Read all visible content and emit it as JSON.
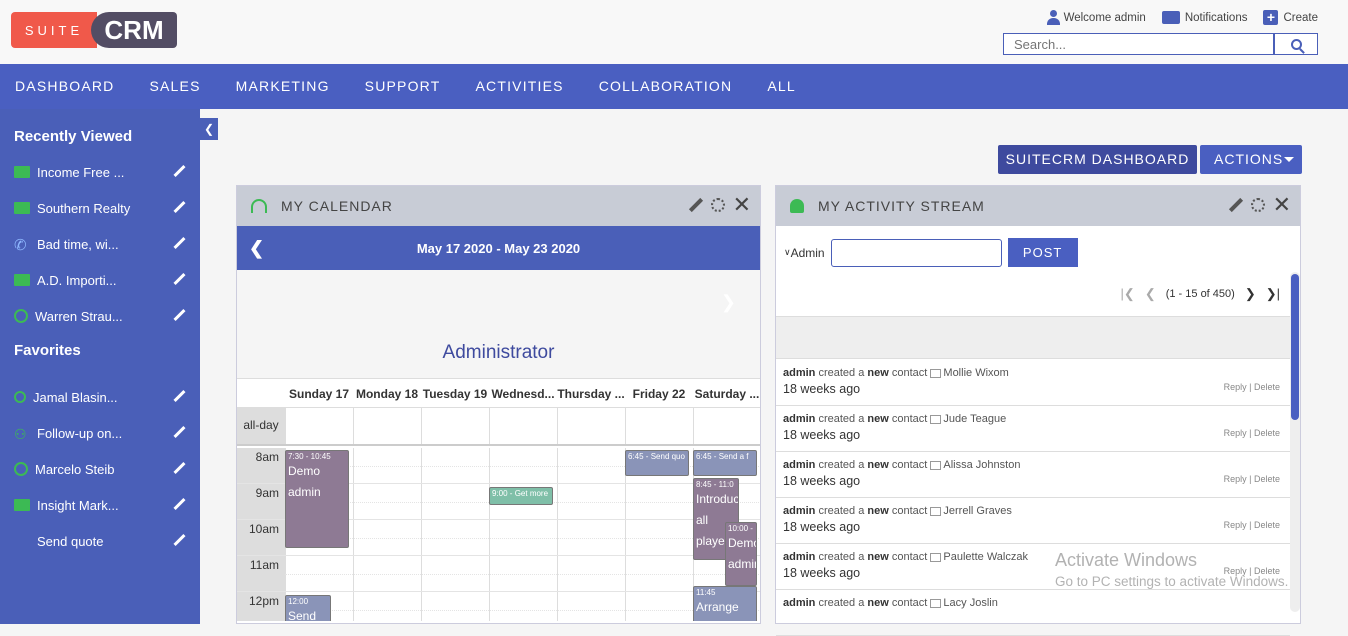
{
  "header": {
    "logo_suite": "SUITE",
    "logo_crm": "CRM",
    "welcome": "Welcome admin",
    "notifications": "Notifications",
    "create": "Create",
    "search_placeholder": "Search..."
  },
  "nav": [
    "DASHBOARD",
    "SALES",
    "MARKETING",
    "SUPPORT",
    "ACTIVITIES",
    "COLLABORATION",
    "ALL"
  ],
  "sidebar": {
    "recent_title": "Recently Viewed",
    "recent": [
      {
        "label": "Income Free ...",
        "icon": "folder-icon"
      },
      {
        "label": "Southern Realty",
        "icon": "folder-icon"
      },
      {
        "label": "Bad time, wi...",
        "icon": "phone-icon"
      },
      {
        "label": "A.D. Importi...",
        "icon": "folder-icon"
      },
      {
        "label": "Warren Strau...",
        "icon": "contact-icon"
      }
    ],
    "fav_title": "Favorites",
    "favorites": [
      {
        "label": "Jamal Blasin...",
        "icon": "search-icon"
      },
      {
        "label": "Follow-up on...",
        "icon": "binoculars-icon"
      },
      {
        "label": "Marcelo Steib",
        "icon": "contact-icon"
      },
      {
        "label": "Insight Mark...",
        "icon": "folder-icon"
      },
      {
        "label": "Send quote",
        "icon": ""
      }
    ]
  },
  "toolbar": {
    "dashboard_label": "SUITECRM DASHBOARD",
    "actions_label": "ACTIONS"
  },
  "calendar": {
    "title": "MY CALENDAR",
    "range": "May 17 2020 - May 23 2020",
    "user": "Administrator",
    "allday": "all-day",
    "days": [
      "Sunday 17",
      "Monday 18",
      "Tuesday 19",
      "Wednesd...",
      "Thursday ...",
      "Friday 22",
      "Saturday ..."
    ],
    "hours": [
      "8am",
      "9am",
      "10am",
      "11am",
      "12pm"
    ],
    "events": [
      {
        "time": "7:30 - 10:45",
        "title1": "Demo",
        "title2": "admin",
        "color": "#8e7a94"
      },
      {
        "time": "9:00 -",
        "title1": "Get more",
        "color": "#7fbfa8"
      },
      {
        "time": "6:45 -",
        "title1": "Send quo",
        "color": "#8a94b8"
      },
      {
        "time": "6:45 -",
        "title1": "Send a f",
        "color": "#8a94b8"
      },
      {
        "time": "8:45 - 11:0",
        "title1": "Introduc",
        "title2": "all",
        "title3": "playe",
        "color": "#8e7a94"
      },
      {
        "time": "10:00 -",
        "title1": "Demo",
        "title2": "admin",
        "color": "#8e7a94"
      },
      {
        "time": "12:00",
        "title1": "Send",
        "color": "#8a94b8"
      },
      {
        "time": "11:45",
        "title1": "Arrange",
        "color": "#8a94b8"
      }
    ]
  },
  "stream": {
    "title": "MY ACTIVITY STREAM",
    "user": "Admin",
    "post_label": "POST",
    "pagination": "(1 - 15 of 450)",
    "entries": [
      {
        "who": "admin",
        "mid": "created a",
        "new": "new",
        "type": "contact",
        "name": "Mollie Wixom",
        "ago": "18 weeks ago"
      },
      {
        "who": "admin",
        "mid": "created a",
        "new": "new",
        "type": "contact",
        "name": "Jude Teague",
        "ago": "18 weeks ago"
      },
      {
        "who": "admin",
        "mid": "created a",
        "new": "new",
        "type": "contact",
        "name": "Alissa Johnston",
        "ago": "18 weeks ago"
      },
      {
        "who": "admin",
        "mid": "created a",
        "new": "new",
        "type": "contact",
        "name": "Jerrell Graves",
        "ago": "18 weeks ago"
      },
      {
        "who": "admin",
        "mid": "created a",
        "new": "new",
        "type": "contact",
        "name": "Paulette Walczak",
        "ago": "18 weeks ago"
      },
      {
        "who": "admin",
        "mid": "created a",
        "new": "new",
        "type": "contact",
        "name": "Lacy Joslin",
        "ago": ""
      }
    ],
    "reply_delete": "Reply | Delete"
  },
  "watermark": {
    "line1": "Activate Windows",
    "line2": "Go to PC settings to activate Windows."
  },
  "colors": {
    "brand": "#4a5fc1",
    "sidebar": "#4a5fb8",
    "logo_red": "#f0594a",
    "logo_dark": "#534d64"
  }
}
